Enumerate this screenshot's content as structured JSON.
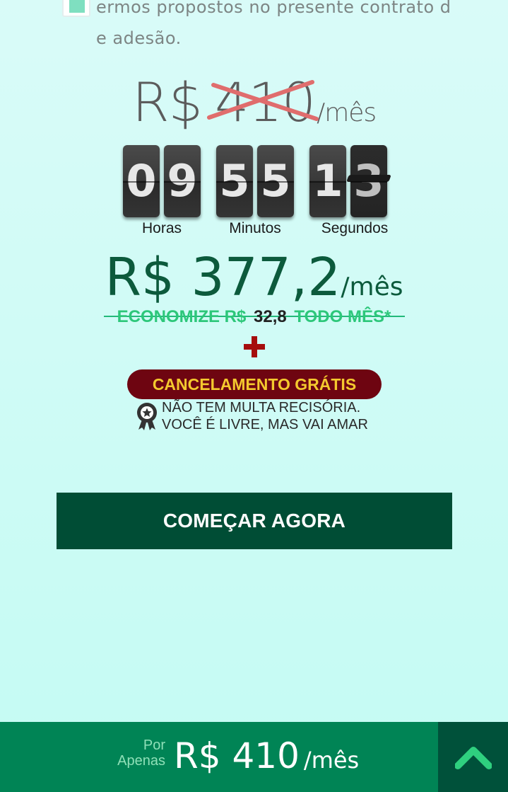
{
  "terms": {
    "text_line1": "ermos propostos no presente contrato d",
    "text_line2": "e adesão."
  },
  "old_price": {
    "currency": "R$",
    "value": "410",
    "per": "/mês"
  },
  "timer": {
    "hours": [
      "0",
      "9"
    ],
    "minutes": [
      "5",
      "5"
    ],
    "seconds": [
      "1",
      "3"
    ],
    "labels": {
      "hours": "Horas",
      "minutes": "Minutos",
      "seconds": "Segundos"
    }
  },
  "new_price": {
    "currency": "R$",
    "value": "377,2",
    "per": "/mês"
  },
  "savings": {
    "prefix": "ECONOMIZE R$",
    "amount": "32,8",
    "suffix": "TODO MÊS*"
  },
  "cancel_badge": "CANCELAMENTO GRÁTIS",
  "notice": {
    "line1": "NÃO TEM MULTA RECISÓRIA.",
    "line2": "VOCÊ É LIVRE, MAS VAI AMAR"
  },
  "cta": {
    "label": "COMEÇAR AGORA"
  },
  "bottom_bar": {
    "por": "Por",
    "apenas": "Apenas",
    "currency": "R$",
    "value": "410",
    "per": "/mês"
  },
  "colors": {
    "background": "#c9fbf4",
    "cta": "#004d35",
    "accent_green": "#2dc77a",
    "badge": "#6e0511",
    "badge_text": "#f4c92e",
    "bottom_bar": "#008455"
  },
  "icons": {
    "plus": "plus-icon",
    "award": "award-ribbon-icon",
    "scroll_top": "chevron-up-icon"
  }
}
